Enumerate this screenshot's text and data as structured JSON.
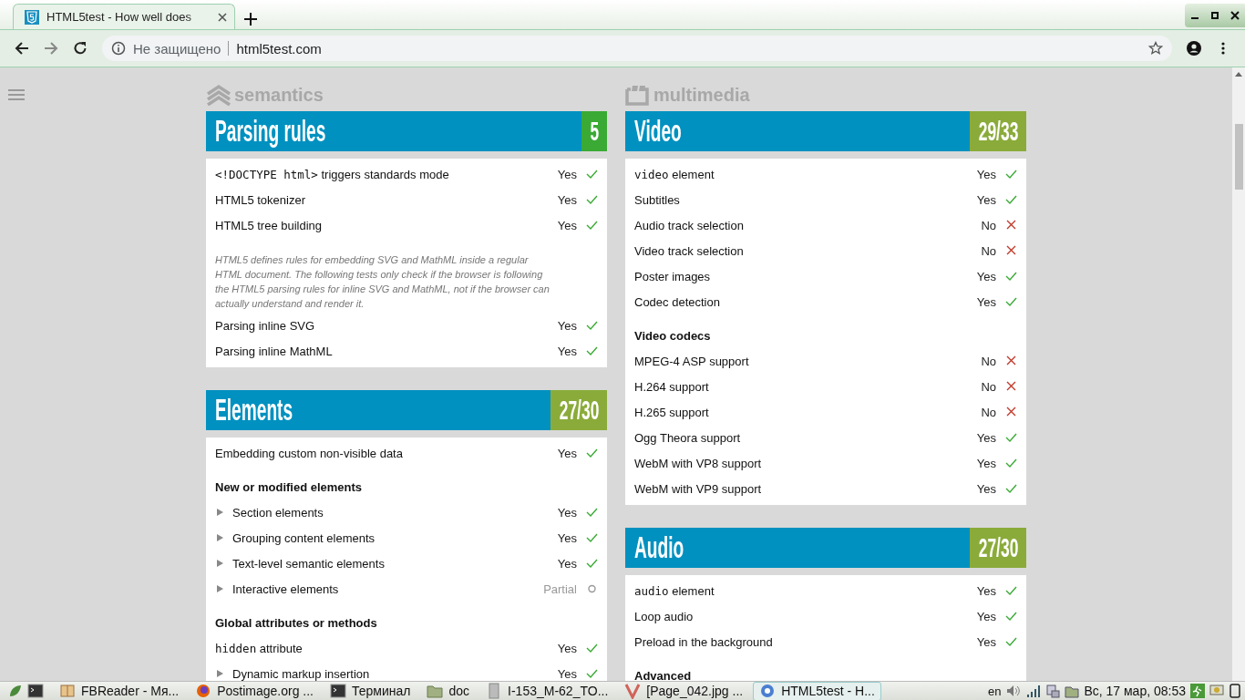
{
  "browser": {
    "tab": {
      "title": "HTML5test - How well does"
    },
    "address": {
      "security": "Не защищено",
      "url": "html5test.com"
    }
  },
  "columns": [
    {
      "kind": "semantics",
      "category": "semantics",
      "sections": [
        {
          "title": "Parsing rules",
          "score": "5",
          "color": "#3aaa35",
          "rows": [
            {
              "kind": "pass",
              "code": "<!DOCTYPE html>",
              "label": " triggers standards mode",
              "result": "Yes"
            },
            {
              "kind": "pass",
              "label": "HTML5 tokenizer",
              "result": "Yes"
            },
            {
              "kind": "pass",
              "label": "HTML5 tree building",
              "result": "Yes"
            },
            {
              "kind": "note",
              "label": "HTML5 defines rules for embedding SVG and MathML inside a regular HTML document. The following tests only check if the browser is following the HTML5 parsing rules for inline SVG and MathML, not if the browser can actually understand and render it."
            },
            {
              "kind": "pass",
              "label": "Parsing inline SVG",
              "result": "Yes"
            },
            {
              "kind": "pass",
              "label": "Parsing inline MathML",
              "result": "Yes"
            }
          ]
        },
        {
          "title": "Elements",
          "score": "27/30",
          "color": "#8aab3a",
          "rows": [
            {
              "kind": "pass",
              "label": "Embedding custom non-visible data",
              "result": "Yes"
            },
            {
              "kind": "heading",
              "label": "New or modified elements"
            },
            {
              "kind": "pass",
              "expandable": true,
              "label": "Section elements",
              "result": "Yes"
            },
            {
              "kind": "pass",
              "expandable": true,
              "label": "Grouping content elements",
              "result": "Yes"
            },
            {
              "kind": "pass",
              "expandable": true,
              "label": "Text-level semantic elements",
              "result": "Yes"
            },
            {
              "kind": "partial",
              "expandable": true,
              "label": "Interactive elements",
              "result": "Partial"
            },
            {
              "kind": "heading",
              "label": "Global attributes or methods"
            },
            {
              "kind": "pass",
              "code": "hidden",
              "label": " attribute",
              "result": "Yes"
            },
            {
              "kind": "pass",
              "expandable": true,
              "label": "Dynamic markup insertion",
              "result": "Yes"
            }
          ]
        }
      ]
    },
    {
      "kind": "multimedia",
      "category": "multimedia",
      "sections": [
        {
          "title": "Video",
          "score": "29/33",
          "color": "#8aab3a",
          "rows": [
            {
              "kind": "pass",
              "code": "video",
              "label": " element",
              "result": "Yes"
            },
            {
              "kind": "pass",
              "label": "Subtitles",
              "result": "Yes"
            },
            {
              "kind": "fail",
              "label": "Audio track selection",
              "result": "No"
            },
            {
              "kind": "fail",
              "label": "Video track selection",
              "result": "No"
            },
            {
              "kind": "pass",
              "label": "Poster images",
              "result": "Yes"
            },
            {
              "kind": "pass",
              "label": "Codec detection",
              "result": "Yes"
            },
            {
              "kind": "heading",
              "label": "Video codecs"
            },
            {
              "kind": "fail",
              "label": "MPEG-4 ASP support",
              "result": "No"
            },
            {
              "kind": "fail",
              "label": "H.264 support",
              "result": "No"
            },
            {
              "kind": "fail",
              "label": "H.265 support",
              "result": "No"
            },
            {
              "kind": "pass",
              "label": "Ogg Theora support",
              "result": "Yes"
            },
            {
              "kind": "pass",
              "label": "WebM with VP8 support",
              "result": "Yes"
            },
            {
              "kind": "pass",
              "label": "WebM with VP9 support",
              "result": "Yes"
            }
          ]
        },
        {
          "title": "Audio",
          "score": "27/30",
          "color": "#8aab3a",
          "rows": [
            {
              "kind": "pass",
              "code": "audio",
              "label": " element",
              "result": "Yes"
            },
            {
              "kind": "pass",
              "label": "Loop audio",
              "result": "Yes"
            },
            {
              "kind": "pass",
              "label": "Preload in the background",
              "result": "Yes"
            },
            {
              "kind": "heading",
              "label": "Advanced"
            }
          ]
        }
      ]
    }
  ],
  "taskbar": {
    "items": [
      {
        "kind": "reader",
        "label": "FBReader - Мя...",
        "selected": false
      },
      {
        "kind": "firefox",
        "label": "Postimage.org ...",
        "selected": false
      },
      {
        "kind": "terminal",
        "label": "Терминал",
        "selected": false
      },
      {
        "kind": "folder",
        "label": "doc",
        "selected": false
      },
      {
        "kind": "document",
        "label": "I-153_M-62_TO...",
        "selected": false
      },
      {
        "kind": "viewer",
        "label": "[Page_042.jpg ...",
        "selected": false
      },
      {
        "kind": "chrome",
        "label": "HTML5test - H...",
        "selected": true
      }
    ],
    "language": "en",
    "clock": "Вс, 17 мар, 08:53"
  }
}
